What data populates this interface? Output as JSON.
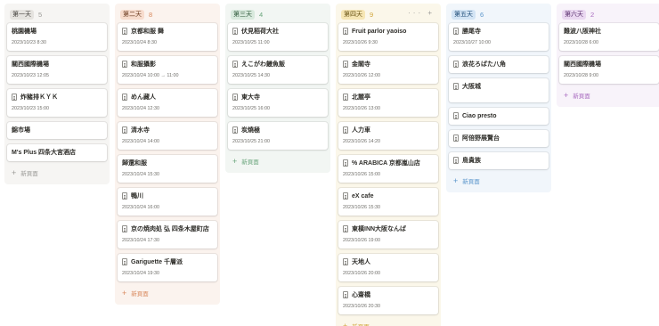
{
  "new_page_label": "新頁面",
  "columns": [
    {
      "title": "第一天",
      "count": "5",
      "colors": {
        "bg": "#f6f5f3",
        "tag": "#e5e3df",
        "tagText": "#44423d",
        "count": "#9b9a97",
        "new": "#9b9a97"
      },
      "cards": [
        {
          "title": "桃園機場",
          "date": "2023/10/23 8:30",
          "icon": false
        },
        {
          "title": "關西國際機場",
          "date": "2023/10/23 12:05",
          "icon": false
        },
        {
          "title": "炸豬排ＫＹＫ",
          "date": "2023/10/23 15:00",
          "icon": true
        },
        {
          "title": "錦市場",
          "date": "",
          "icon": false
        },
        {
          "title": "M's Plus 四条大宮酒店",
          "date": "",
          "icon": false
        }
      ]
    },
    {
      "title": "第二天",
      "count": "8",
      "colors": {
        "bg": "#fbf3ee",
        "tag": "#f7dccd",
        "tagText": "#6b3a1f",
        "count": "#d9895d",
        "new": "#d9895d"
      },
      "cards": [
        {
          "title": "京都和服 舞",
          "date": "2023/10/24 8:30",
          "icon": true
        },
        {
          "title": "和服攝影",
          "date": "2023/10/24 10:00 → 11:00",
          "icon": true
        },
        {
          "title": "めん藏人",
          "date": "2023/10/24 12:30",
          "icon": true
        },
        {
          "title": "清水寺",
          "date": "2023/10/24 14:00",
          "icon": true
        },
        {
          "title": "歸還和服",
          "date": "2023/10/24 15:30",
          "icon": false
        },
        {
          "title": "鴨川",
          "date": "2023/10/24 16:00",
          "icon": true
        },
        {
          "title": "京の焼肉処 弘 四条木屋町店",
          "date": "2023/10/24 17:30",
          "icon": true
        },
        {
          "title": "Gariguette 千層派",
          "date": "2023/10/24 19:30",
          "icon": true
        }
      ]
    },
    {
      "title": "第三天",
      "count": "4",
      "colors": {
        "bg": "#f2f6f3",
        "tag": "#d8e9dd",
        "tagText": "#2f5a3c",
        "count": "#6aa57c",
        "new": "#6aa57c"
      },
      "cards": [
        {
          "title": "伏見稻荷大社",
          "date": "2023/10/25 11:00",
          "icon": true
        },
        {
          "title": "えこがわ鰻魚飯",
          "date": "2023/10/25 14:30",
          "icon": true
        },
        {
          "title": "東大寺",
          "date": "2023/10/25 16:00",
          "icon": true
        },
        {
          "title": "炭燒極",
          "date": "2023/10/25 21:00",
          "icon": true
        }
      ]
    },
    {
      "title": "第四天",
      "count": "9",
      "colors": {
        "bg": "#fbf7ea",
        "tag": "#f6e6b4",
        "tagText": "#6a5414",
        "count": "#d1a63c",
        "new": "#d1a63c"
      },
      "head_icons": "··· +",
      "cards": [
        {
          "title": "Fruit parlor yaoiso",
          "date": "2023/10/26 9:30",
          "icon": true
        },
        {
          "title": "金閣寺",
          "date": "2023/10/26 12:00",
          "icon": true
        },
        {
          "title": "北麓亭",
          "date": "2023/10/26 13:00",
          "icon": true
        },
        {
          "title": "人力車",
          "date": "2023/10/26 14:20",
          "icon": true
        },
        {
          "title": "% ARABICA 京都嵐山店",
          "date": "2023/10/26 15:00",
          "icon": true
        },
        {
          "title": "eX cafe",
          "date": "2023/10/26 15:30",
          "icon": true
        },
        {
          "title": "東橫INN大阪なんば",
          "date": "2023/10/26 19:00",
          "icon": true
        },
        {
          "title": "天地人",
          "date": "2023/10/26 20:00",
          "icon": true
        },
        {
          "title": "心齋橋",
          "date": "2023/10/26 20:30",
          "icon": true
        }
      ]
    },
    {
      "title": "第五天",
      "count": "6",
      "colors": {
        "bg": "#f1f6fb",
        "tag": "#d3e4f4",
        "tagText": "#1f4d78",
        "count": "#5a95cb",
        "new": "#5a95cb"
      },
      "cards": [
        {
          "title": "勝尾寺",
          "date": "2023/10/27 10:00",
          "icon": true
        },
        {
          "title": "浪花ろばた八角",
          "date": "",
          "icon": true
        },
        {
          "title": "大阪城",
          "date": "",
          "icon": true,
          "tall": true
        },
        {
          "title": "Ciao presto",
          "date": "",
          "icon": true
        },
        {
          "title": "阿倍野展覽台",
          "date": "",
          "icon": true
        },
        {
          "title": "鳥貴族",
          "date": "",
          "icon": true
        }
      ]
    },
    {
      "title": "第六天",
      "count": "2",
      "colors": {
        "bg": "#f8f3fa",
        "tag": "#ead8f1",
        "tagText": "#5b2f6e",
        "count": "#a96cc0",
        "new": "#a96cc0"
      },
      "cards": [
        {
          "title": "難波八阪神社",
          "date": "2023/10/28 6:00",
          "icon": false
        },
        {
          "title": "關西國際機場",
          "date": "2023/10/28 9:00",
          "icon": false
        }
      ]
    }
  ]
}
